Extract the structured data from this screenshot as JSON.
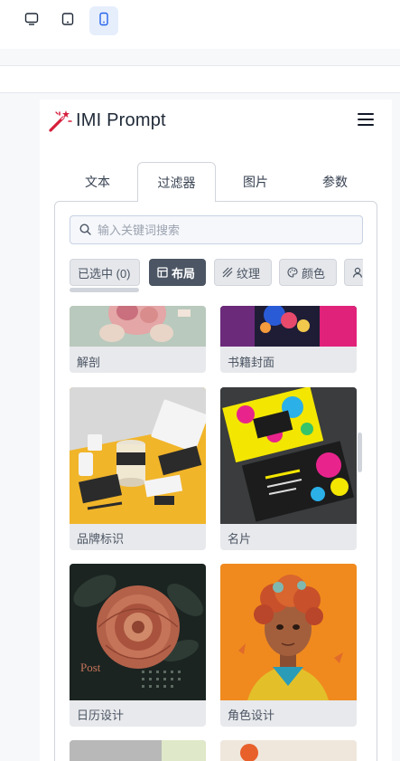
{
  "app": {
    "title": "IMI Prompt",
    "colors": {
      "accent": "#2563eb",
      "brand_red": "#d61f3c",
      "chip_dark": "#4b5563"
    }
  },
  "device_toggles": [
    {
      "name": "desktop-view",
      "icon": "monitor-icon",
      "active": false
    },
    {
      "name": "tablet-view",
      "icon": "tablet-icon",
      "active": false
    },
    {
      "name": "mobile-view",
      "icon": "phone-icon",
      "active": true
    }
  ],
  "tabs": [
    {
      "label": "文本",
      "active": false
    },
    {
      "label": "过滤器",
      "active": true
    },
    {
      "label": "图片",
      "active": false
    },
    {
      "label": "参数",
      "active": false
    }
  ],
  "search": {
    "placeholder": "输入关键词搜索",
    "value": ""
  },
  "chips": [
    {
      "label": "已选中 (0)",
      "icon": "",
      "active": false
    },
    {
      "label": "布局",
      "icon": "layout-icon",
      "active": true
    },
    {
      "label": "纹理",
      "icon": "texture-icon",
      "active": false
    },
    {
      "label": "颜色",
      "icon": "palette-icon",
      "active": false
    },
    {
      "label": "",
      "icon": "user-icon",
      "active": false
    }
  ],
  "cards": [
    {
      "label": "解剖",
      "thumb": "anatomy-image"
    },
    {
      "label": "书籍封面",
      "thumb": "book-cover-image"
    },
    {
      "label": "品牌标识",
      "thumb": "brand-identity-image"
    },
    {
      "label": "名片",
      "thumb": "business-card-image"
    },
    {
      "label": "日历设计",
      "thumb": "calendar-design-image",
      "thumb_text": "Post"
    },
    {
      "label": "角色设计",
      "thumb": "character-design-image"
    }
  ]
}
